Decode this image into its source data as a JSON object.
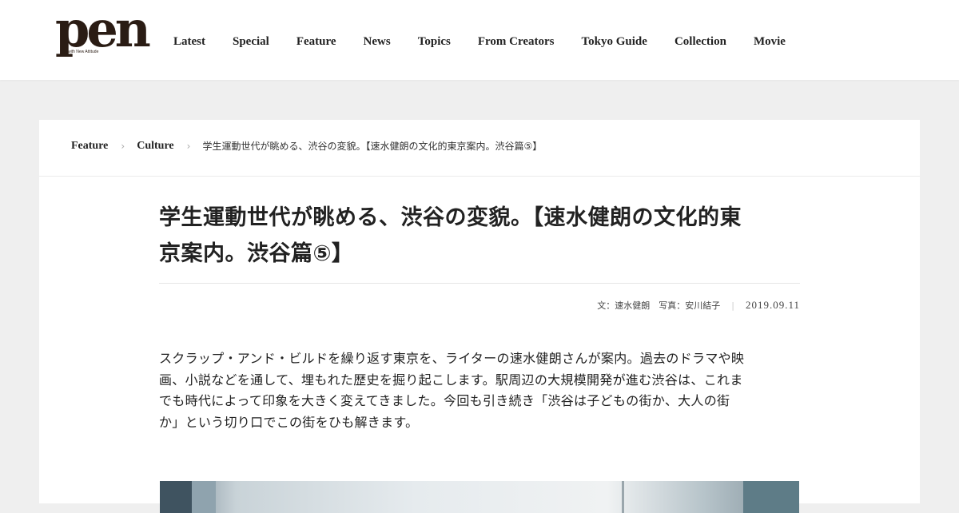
{
  "header": {
    "logo": {
      "word": "pen",
      "tagline": "with New Attitude"
    },
    "nav": [
      {
        "label": "Latest"
      },
      {
        "label": "Special"
      },
      {
        "label": "Feature"
      },
      {
        "label": "News"
      },
      {
        "label": "Topics"
      },
      {
        "label": "From Creators"
      },
      {
        "label": "Tokyo Guide"
      },
      {
        "label": "Collection"
      },
      {
        "label": "Movie"
      }
    ]
  },
  "breadcrumb": {
    "items": [
      "Feature",
      "Culture"
    ],
    "current": "学生運動世代が眺める、渋谷の変貌。【速水健朗の文化的東京案内。渋谷篇⑤】",
    "separator_icon": "chevron-right-icon"
  },
  "article": {
    "title_line1": "学生運動世代が眺める、渋谷の変貌。【速水健朗の文化的東",
    "title_line2": "京案内。渋谷篇⑤】",
    "meta": {
      "credits": "文：速水健朗　写真：安川結子",
      "separator": "|",
      "date": "2019.09.11"
    },
    "lead": [
      "スクラップ・アンド・ビルドを繰り返す東京を、ライターの速水健朗さんが案内。過去のドラマや映",
      "画、小説などを通して、埋もれた歴史を掘り起こします。駅周辺の大規模開発が進む渋谷は、これま",
      "でも時代によって印象を大きく変えてきました。今回も引き続き「渋谷は子どもの街か、大人の街",
      "か」という切り口でこの街をひも解きます。"
    ]
  },
  "colors": {
    "background": "#efefef",
    "header_bg": "#ffffff",
    "card_bg": "#ffffff",
    "logo": "#2a1c14",
    "text": "#222222"
  }
}
